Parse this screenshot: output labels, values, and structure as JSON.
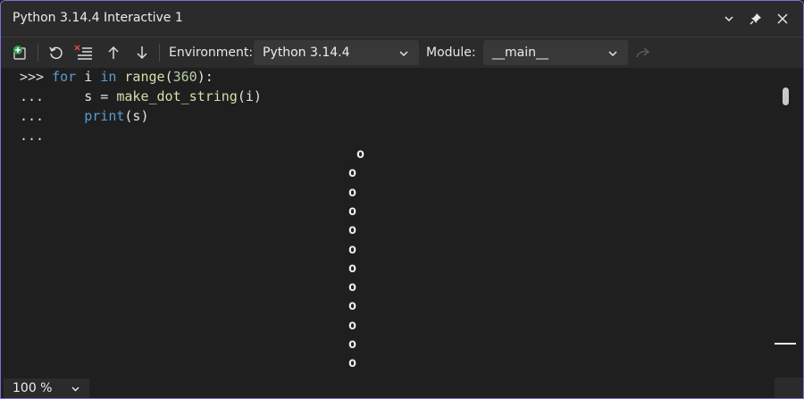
{
  "window": {
    "title": "Python 3.14.4 Interactive 1"
  },
  "title_buttons": [
    "chevron-down-icon",
    "pin-icon",
    "close-icon"
  ],
  "toolbar": {
    "environment_label": "Environment:",
    "environment_value": "Python 3.14.4",
    "module_label": "Module:",
    "module_value": "__main__"
  },
  "console": {
    "lines": [
      {
        "prompt": ">>>",
        "code": "for i in range(360):"
      },
      {
        "prompt": "...",
        "code": "    s = make_dot_string(i)"
      },
      {
        "prompt": "...",
        "code": "    print(s)"
      },
      {
        "prompt": "...",
        "code": ""
      }
    ],
    "output_glyph": "o",
    "output_count": 12
  },
  "statusbar": {
    "zoom": "100 %"
  }
}
